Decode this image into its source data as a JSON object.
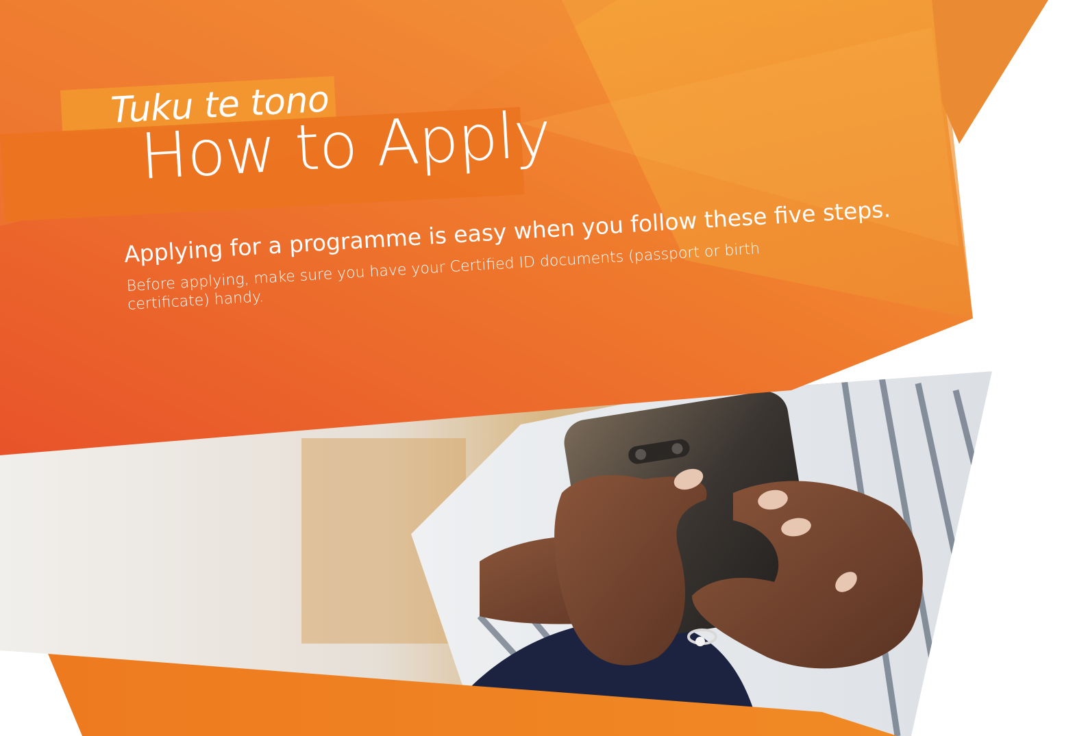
{
  "kicker": "Tuku te tono",
  "title": "How to Apply",
  "lead": "Applying for a programme is easy when you follow these five steps.",
  "body": "Before applying, make sure you have your Certified ID documents (passport or birth certificate) handy.",
  "colors": {
    "orange_dark": "#e8532a",
    "orange_mid": "#ef7b2d",
    "orange_light": "#f5a23a",
    "white": "#ffffff"
  },
  "photo": {
    "subject": "hands-holding-smartphone"
  }
}
